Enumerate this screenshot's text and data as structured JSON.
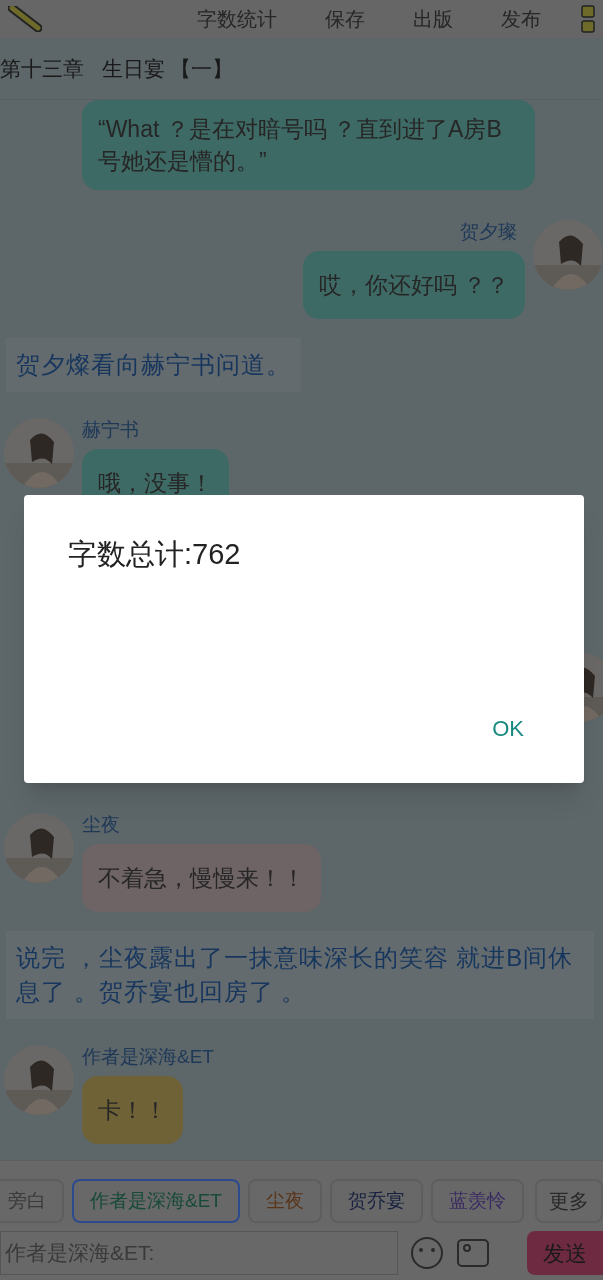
{
  "toolbar": {
    "actions": [
      "字数统计",
      "保存",
      "出版",
      "发布"
    ]
  },
  "chapter_title": "第十三章   生日宴 【一】",
  "messages": [
    {
      "kind": "left",
      "text": "“What ？是在对暗号吗 ？直到进了A房B号她还是懵的。”",
      "color": "#3e6a65"
    },
    {
      "kind": "right",
      "name": "贺夕璨",
      "text": "哎，你还好吗 ？？",
      "color": "#3e6a65"
    },
    {
      "kind": "narration",
      "text": "贺夕燦看向赫宁书问道。"
    },
    {
      "kind": "left",
      "name": "赫宁书",
      "text": "哦，没事！",
      "color": "#3e6a65"
    },
    {
      "kind": "covered"
    },
    {
      "kind": "left",
      "name": "尘夜",
      "text": "不着急，慢慢来！！",
      "color": "#6e6365"
    },
    {
      "kind": "narration",
      "text": "说完 ，尘夜露出了一抹意味深长的笑容 就进B间休息了 。贺乔宴也回房了 。"
    },
    {
      "kind": "left",
      "name": "作者是深海&ET",
      "text": "卡！！",
      "color": "#6e6236"
    }
  ],
  "roles": [
    {
      "label": "旁白",
      "color": "#3a3a3a",
      "selected": false
    },
    {
      "label": "作者是深海&ET",
      "color": "#174a38",
      "selected": true
    },
    {
      "label": "尘夜",
      "color": "#5a3418",
      "selected": false
    },
    {
      "label": "贺乔宴",
      "color": "#18213f",
      "selected": false
    },
    {
      "label": "蓝羡怜",
      "color": "#3a2a62",
      "selected": false
    }
  ],
  "more_button": "更多",
  "input": {
    "placeholder": "作者是深海&ET:"
  },
  "send_button": "发送",
  "dialog": {
    "message": "字数总计:762",
    "ok": "OK"
  }
}
